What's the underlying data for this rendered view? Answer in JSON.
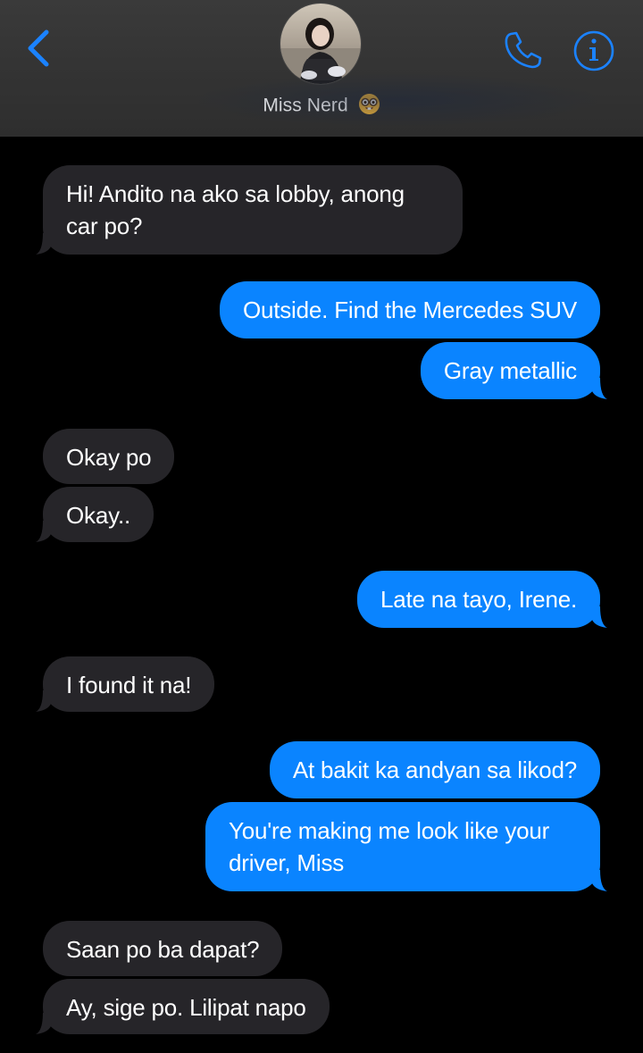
{
  "header": {
    "contact_name": "Miss Nerd",
    "back_icon": "chevron-left-icon",
    "call_icon": "phone-icon",
    "info_icon": "info-icon",
    "name_emoji": "nerd-face-emoji",
    "accent_color": "#1b82ff"
  },
  "colors": {
    "incoming_bubble": "#262529",
    "outgoing_bubble": "#0a84ff",
    "background": "#000000"
  },
  "messages": [
    {
      "sender": "them",
      "text": "Hi! Andito na ako sa lobby, anong car po?"
    },
    {
      "sender": "me",
      "text": "Outside. Find the Mercedes SUV"
    },
    {
      "sender": "me",
      "text": "Gray metallic"
    },
    {
      "sender": "them",
      "text": "Okay po"
    },
    {
      "sender": "them",
      "text": "Okay.."
    },
    {
      "sender": "me",
      "text": "Late na tayo, Irene."
    },
    {
      "sender": "them",
      "text": "I found it na!"
    },
    {
      "sender": "me",
      "text": "At bakit ka andyan sa likod?"
    },
    {
      "sender": "me",
      "text": "You're making me look like your driver, Miss"
    },
    {
      "sender": "them",
      "text": "Saan po ba dapat?"
    },
    {
      "sender": "them",
      "text": "Ay, sige po. Lilipat napo"
    }
  ]
}
